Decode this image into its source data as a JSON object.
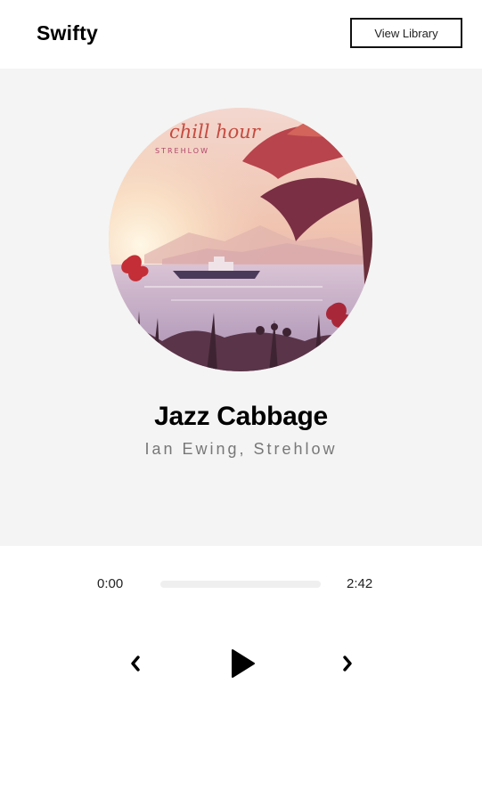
{
  "header": {
    "logo": "Swifty",
    "library_button": "View Library"
  },
  "track": {
    "title": "Jazz Cabbage",
    "artist": "Ian Ewing, Strehlow",
    "cover_lettering": [
      "chill hour",
      "STREHLOW"
    ]
  },
  "player": {
    "current_time": "0:00",
    "duration": "2:42",
    "progress": 0
  },
  "icons": {
    "previous": "chevron-left-icon",
    "play": "play-icon",
    "next": "chevron-right-icon"
  }
}
